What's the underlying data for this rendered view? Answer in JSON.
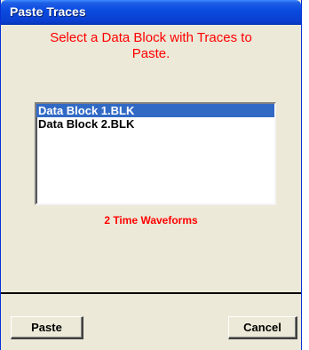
{
  "window": {
    "title": "Paste Traces"
  },
  "prompt": "Select a Data Block with Traces to Paste.",
  "list": {
    "items": [
      "Data Block 1.BLK",
      "Data Block 2.BLK"
    ],
    "selected_index": 0
  },
  "status": "2 Time Waveforms",
  "buttons": {
    "paste": "Paste",
    "cancel": "Cancel"
  },
  "colors": {
    "titlebar": "#0a4be0",
    "prompt_text": "#ff0000",
    "selection": "#316ac5",
    "dialog_bg": "#ece9d8"
  }
}
